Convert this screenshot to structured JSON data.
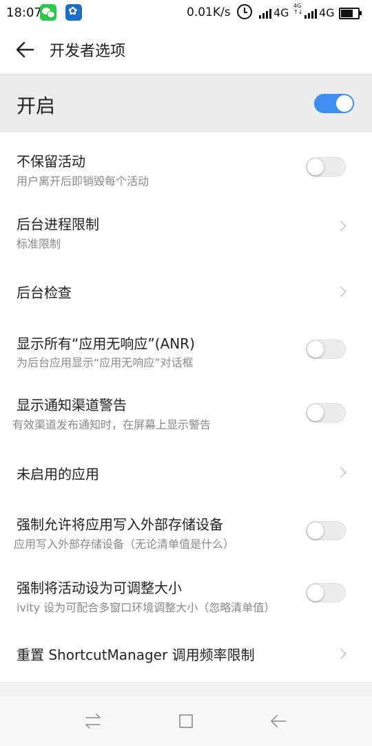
{
  "status_bar": {
    "time": "18:07",
    "net_speed": "0.01K/s",
    "sim1": "4G",
    "sim2": "4G",
    "sim2_small_top": "4G",
    "sim2_small_bottom": "↑↓",
    "icons": [
      "wechat-icon",
      "app-icon",
      "alarm-icon",
      "signal-icon",
      "signal-icon",
      "battery-icon"
    ]
  },
  "header": {
    "title": "开发者选项",
    "back_icon": "arrow-left-icon"
  },
  "master": {
    "label": "开启",
    "enabled": true,
    "accent_color": "#3d8ef0"
  },
  "settings": [
    {
      "title": "不保留活动",
      "subtitle": "用户离开后即销毁每个活动",
      "control": "toggle",
      "on": false
    },
    {
      "title": "后台进程限制",
      "subtitle": "标准限制",
      "control": "chevron"
    },
    {
      "title": "后台检查",
      "subtitle": "",
      "control": "chevron"
    },
    {
      "title": "显示所有“应用无响应”(ANR)",
      "subtitle": "为后台应用显示“应用无响应”对话框",
      "control": "toggle",
      "on": false
    },
    {
      "title": "显示通知渠道警告",
      "subtitle": "有效渠道发布通知时，在屏幕上显示警告",
      "control": "toggle",
      "on": false
    },
    {
      "title": "未启用的应用",
      "subtitle": "",
      "control": "chevron"
    },
    {
      "title": "强制允许将应用写入外部存储设备",
      "subtitle": "应用写入外部存储设备（无论清单值是什么）",
      "control": "toggle",
      "on": false
    },
    {
      "title": "强制将活动设为可调整大小",
      "subtitle": "ivity 设为可配合多窗口环境调整大小（忽略清单值）",
      "control": "toggle",
      "on": false
    },
    {
      "title": "重置 ShortcutManager 调用频率限制",
      "subtitle": "",
      "control": "chevron"
    }
  ],
  "nav_bar": {
    "buttons": [
      "switch-apps-icon",
      "home-square-icon",
      "back-arrow-icon"
    ]
  }
}
